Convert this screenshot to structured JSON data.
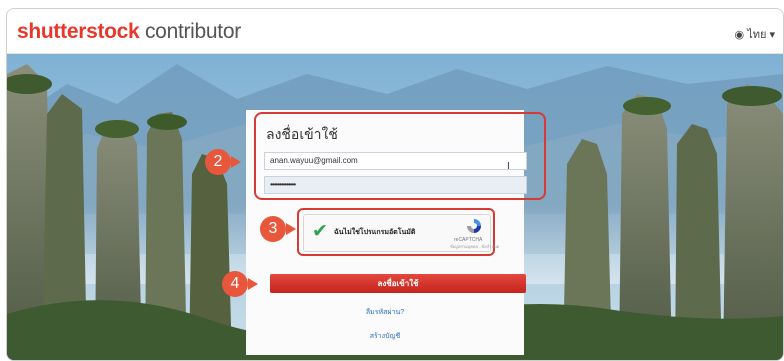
{
  "header": {
    "logo_brand": "shutterstock",
    "logo_sub": "contributor",
    "language": "ไทย ▾"
  },
  "form": {
    "title": "ลงชื่อเข้าใช้",
    "email": "anan.wayuu@gmail.com",
    "password_mask": "••••••••••••••",
    "text_cursor": "I",
    "captcha_label": "ฉันไม่ใช่โปรแกรมอัตโนมัติ",
    "captcha_brand": "reCAPTCHA",
    "captcha_links": "ข้อมูลส่วนบุคคล - ข้อกำหนด",
    "login_button": "ลงชื่อเข้าใช้",
    "forgot_password": "ลืมรหัสผ่าน?",
    "create_account": "สร้างบัญชี"
  },
  "steps": [
    "2",
    "3",
    "4"
  ],
  "colors": {
    "brand": "#e8372b",
    "callout": "#e8573c",
    "highlight_border": "#d63a35",
    "link": "#2b6fbf"
  }
}
